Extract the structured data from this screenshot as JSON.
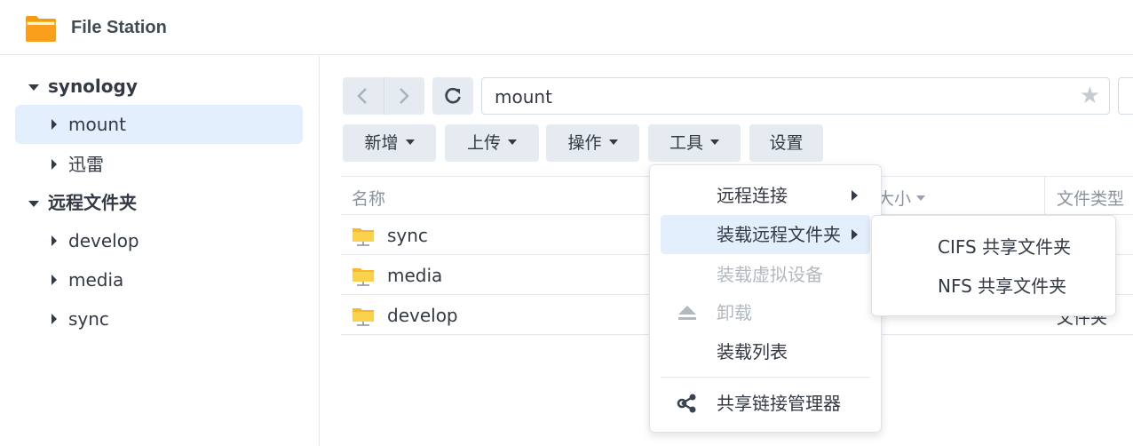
{
  "app": {
    "title": "File Station",
    "icon": "folder-app-icon"
  },
  "sidebar": {
    "roots": [
      {
        "label": "synology",
        "expanded": true,
        "children": [
          {
            "label": "mount",
            "selected": true
          },
          {
            "label": "迅雷",
            "selected": false
          }
        ]
      },
      {
        "label": "远程文件夹",
        "expanded": true,
        "children": [
          {
            "label": "develop"
          },
          {
            "label": "media"
          },
          {
            "label": "sync"
          }
        ]
      }
    ]
  },
  "toolbar": {
    "path": "mount",
    "buttons": {
      "new": "新增",
      "upload": "上传",
      "action": "操作",
      "tools": "工具",
      "settings": "设置"
    }
  },
  "file_list": {
    "columns": {
      "name": "名称",
      "size": "大小",
      "type": "文件类型"
    },
    "rows": [
      {
        "name": "sync",
        "type": ""
      },
      {
        "name": "media",
        "type": ""
      },
      {
        "name": "develop",
        "type": "文件夹"
      }
    ]
  },
  "tools_menu": {
    "items": [
      {
        "label": "远程连接",
        "submenu": true,
        "disabled": false
      },
      {
        "label": "装载远程文件夹",
        "submenu": true,
        "disabled": false,
        "hover": true
      },
      {
        "label": "装载虚拟设备",
        "submenu": false,
        "disabled": true
      },
      {
        "label": "卸载",
        "submenu": false,
        "disabled": true,
        "icon": "eject-icon"
      },
      {
        "label": "装载列表",
        "submenu": false,
        "disabled": false
      },
      {
        "label": "共享链接管理器",
        "submenu": false,
        "disabled": false,
        "icon": "share-link-icon"
      }
    ]
  },
  "mount_submenu": {
    "items": [
      {
        "label": "CIFS 共享文件夹"
      },
      {
        "label": "NFS 共享文件夹"
      }
    ]
  },
  "colors": {
    "accent_bg": "#e3effc",
    "button_bg": "#e6ebf1",
    "folder_yellow": "#f7c640",
    "text": "#333a44",
    "muted": "#8b949e"
  }
}
